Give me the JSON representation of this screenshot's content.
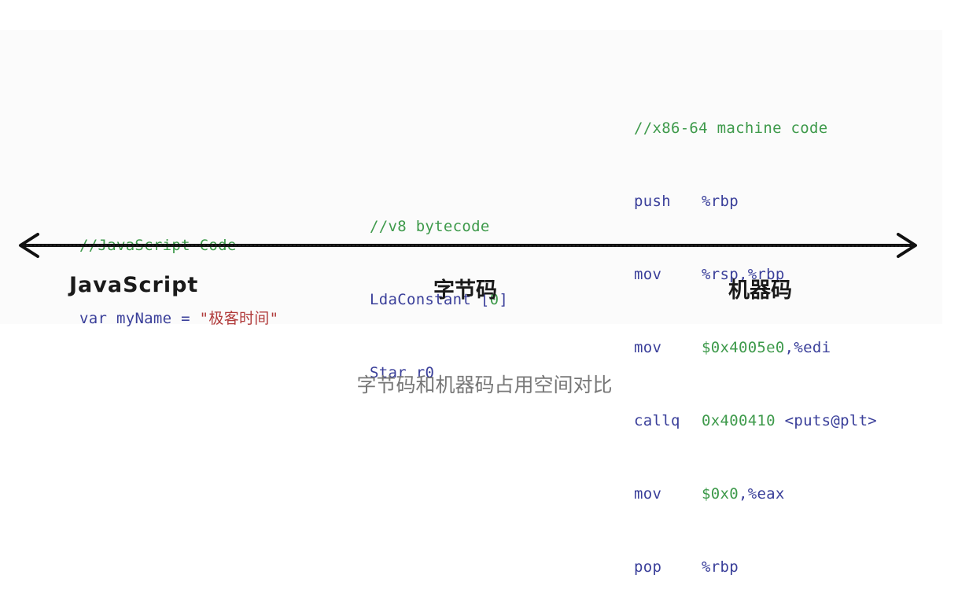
{
  "javascript": {
    "comment": "//JavaScript Code",
    "kw": "var",
    "ident": "myName",
    "eq": "=",
    "string": "\"极客时间\""
  },
  "bytecode": {
    "comment": "//v8 bytecode",
    "line1_op": "LdaConstant",
    "line1_open": "[",
    "line1_num": "0",
    "line1_close": "]",
    "line2_op": "Star",
    "line2_arg": "r0"
  },
  "machine_code": {
    "comment": "//x86-64 machine code",
    "lines": [
      {
        "op": "push",
        "args": "%rbp"
      },
      {
        "op": "mov",
        "args": "%rsp,%rbp"
      },
      {
        "op": "mov",
        "args_num": "$0x4005e0",
        "args_rest": ",%edi"
      },
      {
        "op": "callq",
        "args_num": "0x400410",
        "args_rest": " <puts@plt>"
      },
      {
        "op": "mov",
        "args_num": "$0x0",
        "args_rest": ",%eax"
      },
      {
        "op": "pop",
        "args": "%rbp"
      }
    ]
  },
  "axis_labels": {
    "javascript": "JavaScript",
    "bytecode": "字节码",
    "machine_code": "机器码"
  },
  "caption": "字节码和机器码占用空间对比",
  "colors": {
    "comment": "#3e9a4b",
    "keyword": "#3a3f9a",
    "string": "#b13b3b",
    "axis": "#111111"
  }
}
